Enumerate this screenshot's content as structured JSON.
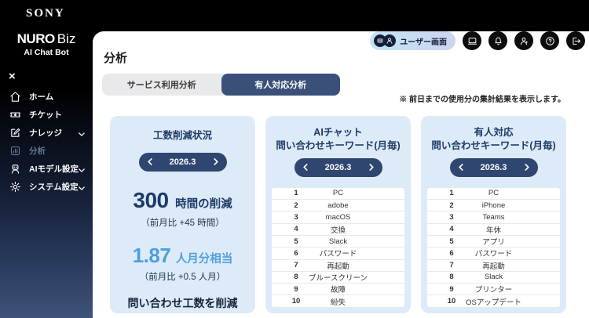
{
  "brand": {
    "sony": "SONY",
    "product_main": "NURO",
    "product_suffix": "Biz",
    "product_sub": "AI Chat Bot",
    "close_glyph": "×"
  },
  "sidebar": {
    "items": [
      {
        "label": "ホーム",
        "icon": "home",
        "active": false,
        "chevron": false
      },
      {
        "label": "チケット",
        "icon": "ticket",
        "active": false,
        "chevron": false
      },
      {
        "label": "ナレッジ",
        "icon": "edit",
        "active": false,
        "chevron": true
      },
      {
        "label": "分析",
        "icon": "analytics",
        "active": true,
        "chevron": false
      },
      {
        "label": "AIモデル設定",
        "icon": "robot",
        "active": false,
        "chevron": true
      },
      {
        "label": "システム設定",
        "icon": "gear",
        "active": false,
        "chevron": true
      }
    ]
  },
  "header": {
    "page_title": "分析",
    "user_screen_label": "ユーザー画面"
  },
  "tabs": [
    {
      "label": "サービス利用分析",
      "active": false
    },
    {
      "label": "有人対応分析",
      "active": true
    }
  ],
  "note": "※ 前日までの使用分の集計結果を表示します。",
  "cards": {
    "effort": {
      "title": "工数削減状況",
      "period": "2026.3",
      "hours_value": "300",
      "hours_unit": "時間の削減",
      "hours_delta": "（前月比 +45 時間）",
      "months_value": "1.87",
      "months_unit": "人月分相当",
      "months_delta": "（前月比 +0.5 人月）",
      "footer": "問い合わせ工数を削減"
    },
    "ai_keywords": {
      "title_line1": "AIチャット",
      "title_line2": "問い合わせキーワード(月毎)",
      "period": "2026.3",
      "rows": [
        {
          "rank": "1",
          "keyword": "PC"
        },
        {
          "rank": "2",
          "keyword": "adobe"
        },
        {
          "rank": "3",
          "keyword": "macOS"
        },
        {
          "rank": "4",
          "keyword": "交換"
        },
        {
          "rank": "5",
          "keyword": "Slack"
        },
        {
          "rank": "6",
          "keyword": "パスワード"
        },
        {
          "rank": "7",
          "keyword": "再起動"
        },
        {
          "rank": "8",
          "keyword": "ブルースクリーン"
        },
        {
          "rank": "9",
          "keyword": "故障"
        },
        {
          "rank": "10",
          "keyword": "紛失"
        }
      ]
    },
    "human_keywords": {
      "title_line1": "有人対応",
      "title_line2": "問い合わせキーワード(月毎)",
      "period": "2026.3",
      "rows": [
        {
          "rank": "1",
          "keyword": "PC"
        },
        {
          "rank": "2",
          "keyword": "iPhone"
        },
        {
          "rank": "3",
          "keyword": "Teams"
        },
        {
          "rank": "4",
          "keyword": "年休"
        },
        {
          "rank": "5",
          "keyword": "アプリ"
        },
        {
          "rank": "6",
          "keyword": "パスワード"
        },
        {
          "rank": "7",
          "keyword": "再起動"
        },
        {
          "rank": "8",
          "keyword": "Slack"
        },
        {
          "rank": "9",
          "keyword": "プリンター"
        },
        {
          "rank": "10",
          "keyword": "OSアップデート"
        }
      ]
    }
  },
  "colors": {
    "accent_navy": "#2e4670",
    "dark_navy_text": "#1e3a66",
    "light_blue": "#4da0dc",
    "card_bg": "#ddeaf8",
    "active_tab": "#3a5078",
    "pill_gradient_start": "#c3e4f4",
    "pill_gradient_end": "#ccd4f0"
  }
}
